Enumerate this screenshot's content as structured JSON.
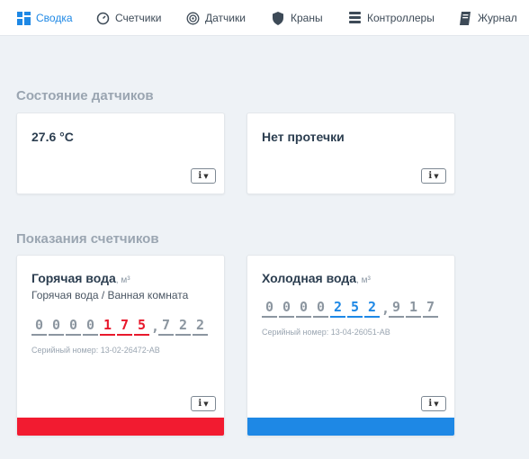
{
  "nav": {
    "items": [
      {
        "label": "Сводка",
        "icon": "dashboard-icon",
        "active": true
      },
      {
        "label": "Счетчики",
        "icon": "gauge-icon"
      },
      {
        "label": "Датчики",
        "icon": "sensor-icon"
      },
      {
        "label": "Краны",
        "icon": "shield-icon"
      },
      {
        "label": "Контроллеры",
        "icon": "stack-icon"
      },
      {
        "label": "Журнал",
        "icon": "book-icon"
      }
    ],
    "accent": "#1e88e5"
  },
  "sensors": {
    "title": "Состояние датчиков",
    "cards": [
      {
        "value": "27.6 °C"
      },
      {
        "value": "Нет протечки"
      }
    ]
  },
  "meters": {
    "title": "Показания счетчиков",
    "info_label": "i",
    "cards": [
      {
        "name": "Горячая вода",
        "unit": ", м³",
        "location": "Горячая вода / Ванная комната",
        "digits_lead": [
          "0",
          "0",
          "0",
          "0"
        ],
        "digits_main": [
          "1",
          "7",
          "5"
        ],
        "digits_frac": [
          "7",
          "2",
          "2"
        ],
        "serial": "Серийный номер: 13-02-26472-AB",
        "color": "#f21b30"
      },
      {
        "name": "Холодная вода",
        "unit": ", м³",
        "location": "",
        "digits_lead": [
          "0",
          "0",
          "0",
          "0"
        ],
        "digits_main": [
          "2",
          "5",
          "2"
        ],
        "digits_frac": [
          "9",
          "1",
          "7"
        ],
        "serial": "Серийный номер: 13-04-26051-AB",
        "color": "#1e88e5"
      }
    ]
  }
}
